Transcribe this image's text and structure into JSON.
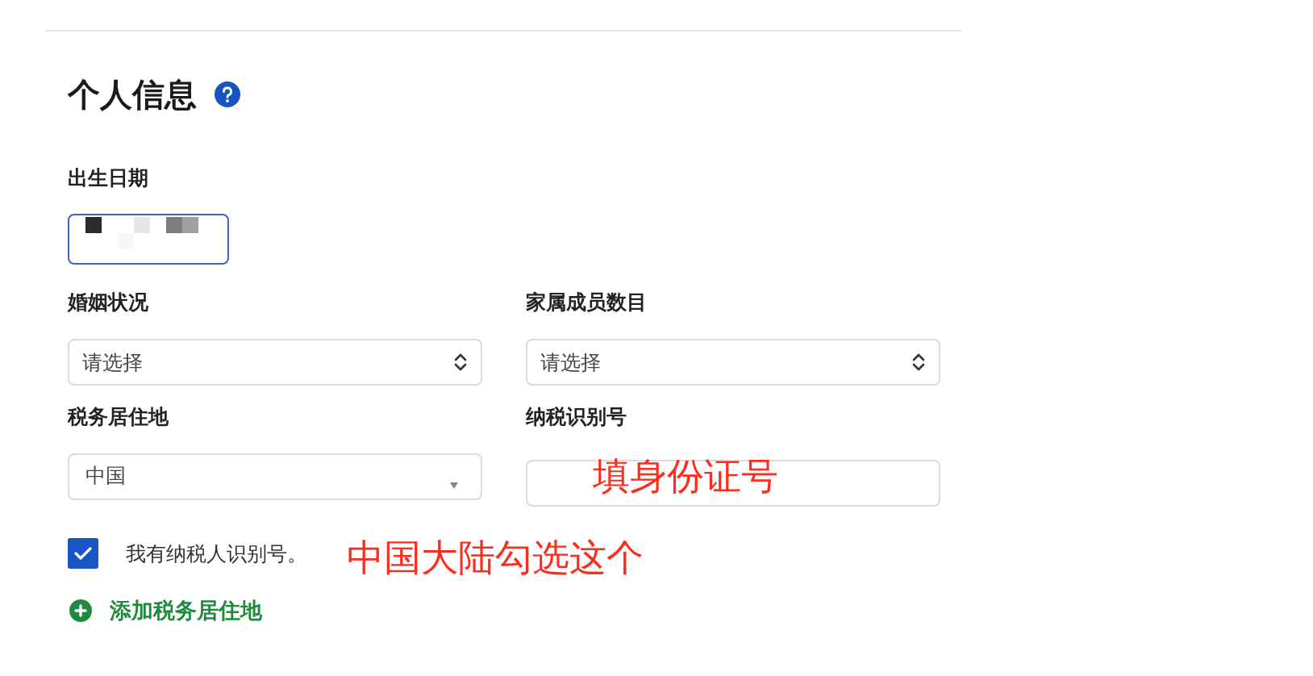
{
  "section": {
    "title": "个人信息"
  },
  "birth_date": {
    "label": "出生日期"
  },
  "fields": [
    {
      "kind": "picker",
      "label": "婚姻状况",
      "placeholder": "请选择"
    },
    {
      "kind": "picker",
      "label": "家属成员数目",
      "placeholder": "请选择"
    },
    {
      "kind": "dropdown",
      "label": "税务居住地",
      "value": "中国"
    },
    {
      "kind": "text",
      "label": "纳税识别号"
    }
  ],
  "tin_checkbox": {
    "label": "我有纳税人识别号。",
    "checked": true
  },
  "add_link": {
    "label": "添加税务居住地"
  },
  "annotations": [
    {
      "text": "填身份证号"
    },
    {
      "text": "中国大陆勾选这个"
    }
  ]
}
